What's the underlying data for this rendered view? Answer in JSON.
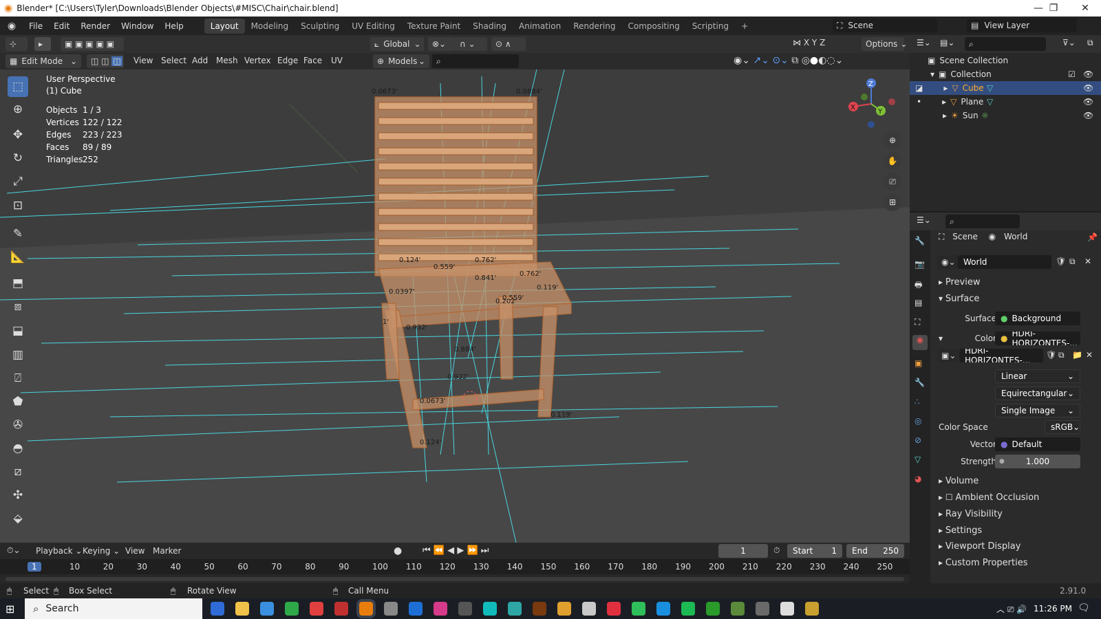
{
  "window": {
    "title": "Blender* [C:\\Users\\Tyler\\Downloads\\Blender Objects\\#MISC\\Chair\\chair.blend]",
    "minimize": "—",
    "maximize": "❐",
    "close": "✕"
  },
  "menu": [
    "File",
    "Edit",
    "Render",
    "Window",
    "Help"
  ],
  "workspaces": [
    "Layout",
    "Modeling",
    "Sculpting",
    "UV Editing",
    "Texture Paint",
    "Shading",
    "Animation",
    "Rendering",
    "Compositing",
    "Scripting",
    "+"
  ],
  "top_right": {
    "scene_label": "Scene",
    "view_layer_label": "View Layer"
  },
  "viewport_header": {
    "transform": "Global",
    "options": "Options",
    "axes": [
      "X",
      "Y",
      "Z"
    ]
  },
  "viewport_header2": {
    "mode": "Edit Mode",
    "menus": [
      "View",
      "Select",
      "Add",
      "Mesh",
      "Vertex",
      "Edge",
      "Face",
      "UV"
    ],
    "collection": "Models"
  },
  "viewport": {
    "perspective": "User Perspective",
    "object": "(1) Cube",
    "stats": [
      {
        "k": "Objects",
        "v": "1 / 3"
      },
      {
        "k": "Vertices",
        "v": "122 / 122"
      },
      {
        "k": "Edges",
        "v": "223 / 223"
      },
      {
        "k": "Faces",
        "v": "89 / 89"
      },
      {
        "k": "Triangles",
        "v": "252"
      }
    ],
    "gizmo": {
      "x": "X",
      "y": "Y",
      "z": "Z"
    },
    "measure_labels": [
      "0.0673'",
      "0.0884'",
      "0.124'",
      "0.559'",
      "0.762'",
      "0.841'",
      "0.932'",
      "0.119'",
      "0.202'",
      "0.0397'",
      "1'",
      "0.884'",
      "0.0673'",
      "0.932'",
      "0.119'",
      "0.124'",
      "0.762'",
      "0.559'"
    ]
  },
  "outliner": {
    "root": "Scene Collection",
    "collection": "Collection",
    "items": [
      "Cube",
      "Plane",
      "Sun"
    ]
  },
  "properties": {
    "breadcrumb_scene": "Scene",
    "breadcrumb_world": "World",
    "world_name": "World",
    "panels": {
      "preview": "Preview",
      "surface": "Surface",
      "volume": "Volume",
      "ao": "Ambient Occlusion",
      "ray": "Ray Visibility",
      "settings": "Settings",
      "viewport_display": "Viewport Display",
      "custom": "Custom Properties"
    },
    "surface_label": "Surface",
    "surface_value": "Background",
    "color_label": "Color",
    "color_value": "HDRI-HORIZONTES-...",
    "image_name": "HDRI-HORIZONTES-...",
    "interp": "Linear",
    "projection": "Equirectangular",
    "source": "Single Image",
    "colorspace_label": "Color Space",
    "colorspace": "sRGB",
    "vector_label": "Vector",
    "vector": "Default",
    "strength_label": "Strength",
    "strength": "1.000"
  },
  "timeline": {
    "menus": [
      "Playback",
      "Keying",
      "View",
      "Marker"
    ],
    "current_frame": "1",
    "start_label": "Start",
    "start": "1",
    "end_label": "End",
    "end": "250",
    "ruler": [
      "1",
      "10",
      "20",
      "30",
      "40",
      "50",
      "60",
      "70",
      "80",
      "90",
      "100",
      "110",
      "120",
      "130",
      "140",
      "150",
      "160",
      "170",
      "180",
      "190",
      "200",
      "210",
      "220",
      "230",
      "240",
      "250"
    ]
  },
  "status": {
    "select": "Select",
    "box_select": "Box Select",
    "rotate": "Rotate View",
    "call_menu": "Call Menu",
    "version": "2.91.0"
  },
  "taskbar": {
    "search": "Search",
    "time": "11:26 PM"
  },
  "colors": {
    "accent": "#4772b3",
    "mesh": "#e8a66f",
    "lines": "#49d6df"
  }
}
